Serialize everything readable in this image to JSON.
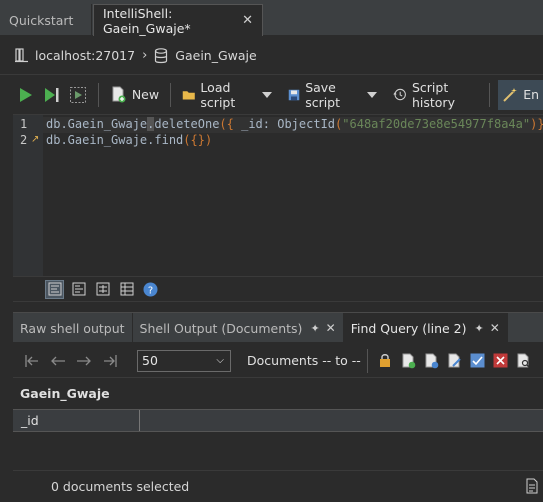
{
  "tabs": [
    {
      "label": "Quickstart"
    },
    {
      "label": "IntelliShell: Gaein_Gwaje*"
    }
  ],
  "breadcrumb": {
    "server": "localhost:27017",
    "database": "Gaein_Gwaje"
  },
  "toolbar": {
    "new_label": "New",
    "load_label": "Load script",
    "save_label": "Save script",
    "history_label": "Script history",
    "en_label": "En"
  },
  "editor": {
    "line1_no": "1",
    "line2_no": "2",
    "l1": {
      "db": "db.Gaein_Gwaje",
      "dot": ".",
      "method": "deleteOne",
      "open": "({",
      "key": " _id: ",
      "fn": "ObjectId",
      "paren_open": "(",
      "str": "\"648af20de73e8e54977f8a4a\"",
      "close": ")})"
    },
    "l2": {
      "db": "db.Gaein_Gwaje.find",
      "args": "({})"
    }
  },
  "result_tabs": [
    {
      "label": "Raw shell output"
    },
    {
      "label": "Shell Output (Documents)"
    },
    {
      "label": "Find Query (line 2)"
    }
  ],
  "results": {
    "page_size": "50",
    "range": "Documents -- to --",
    "collection": "Gaein_Gwaje",
    "columns": [
      "_id"
    ],
    "status": "0 documents selected"
  }
}
